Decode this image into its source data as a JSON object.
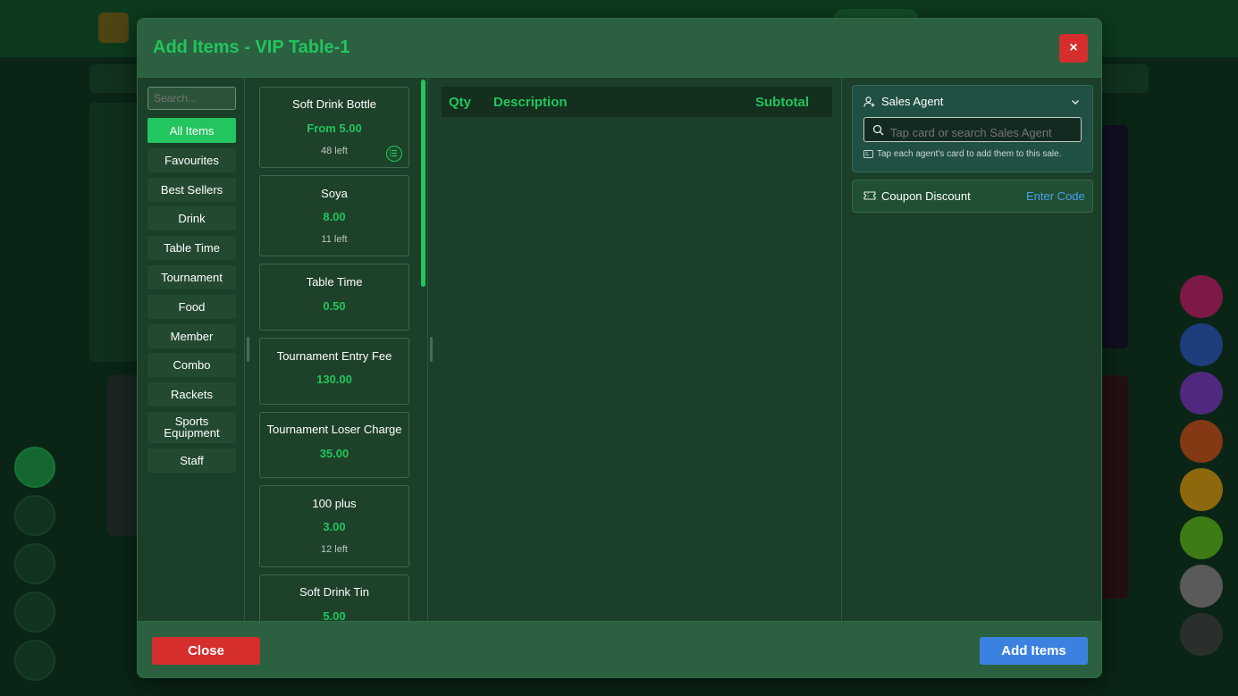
{
  "modal": {
    "title": "Add Items - VIP Table-1",
    "close_symbol": "×"
  },
  "search": {
    "placeholder": "Search..."
  },
  "categories": [
    {
      "label": "All Items",
      "active": true
    },
    {
      "label": "Favourites"
    },
    {
      "label": "Best Sellers"
    },
    {
      "label": "Drink"
    },
    {
      "label": "Table Time"
    },
    {
      "label": "Tournament"
    },
    {
      "label": "Food"
    },
    {
      "label": "Member"
    },
    {
      "label": "Combo"
    },
    {
      "label": "Rackets"
    },
    {
      "label": "Sports Equipment"
    },
    {
      "label": "Staff"
    }
  ],
  "products": [
    {
      "name": "Soft Drink Bottle",
      "price": "From 5.00",
      "stock": "48 left",
      "has_variants": true
    },
    {
      "name": "Soya",
      "price": "8.00",
      "stock": "11 left"
    },
    {
      "name": "Table Time",
      "price": "0.50"
    },
    {
      "name": "Tournament Entry Fee",
      "price": "130.00"
    },
    {
      "name": "Tournament Loser Charge",
      "price": "35.00"
    },
    {
      "name": "100 plus",
      "price": "3.00",
      "stock": "12 left"
    },
    {
      "name": "Soft Drink Tin",
      "price": "5.00"
    }
  ],
  "order": {
    "col_qty": "Qty",
    "col_description": "Description",
    "col_subtotal": "Subtotal"
  },
  "sales_agent": {
    "title": "Sales Agent",
    "placeholder": "Tap card or search Sales Agent",
    "hint": "Tap each agent's card to add them to this sale."
  },
  "coupon": {
    "label": "Coupon Discount",
    "link": "Enter Code"
  },
  "footer": {
    "close_label": "Close",
    "add_label": "Add Items"
  },
  "colors": {
    "accent": "#22c55e",
    "danger": "#d62d2d",
    "primary": "#3b82e0"
  }
}
